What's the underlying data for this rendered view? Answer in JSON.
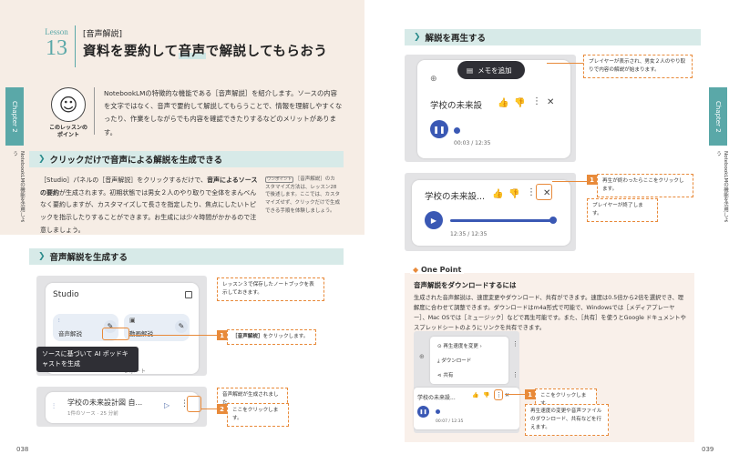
{
  "chapter_tab": {
    "label": "Chapter 2",
    "subtitle": "NotebookLMの機能を活用しよう"
  },
  "lesson": {
    "word": "Lesson",
    "number": "13",
    "tag": "[音声解説]",
    "title_a": "資料を要約して",
    "title_b": "音声",
    "title_c": "で",
    "title_d": "解説してもらおう"
  },
  "point_caption": "このレッスンの\nポイント",
  "intro": "NotebookLMの特徴的な機能である［音声解説］を紹介します。ソースの内容を文字ではなく、音声で要約して解説してもらうことで、情報を理解しやすくなったり、作業をしながらでも内容を確認できたりするなどのメリットがあります。",
  "section1": {
    "title": "クリックだけで音声による解説を生成できる",
    "body_a": "［Studio］パネルの［音声解説］をクリックするだけで、",
    "body_b": "音声によるソースの要約",
    "body_c": "が生成されます。初期状態では男女２人のやり取りで全体をまんべんなく要約しますが、カスタマイズして長さを指定したり、焦点にしたいトピックを指示したりすることができます。お生成には少々時間がかかるので注意しましょう。",
    "note_tag": "ワンポイント",
    "note": "［音声解説］のカスタマイズ方法は、レッスン28で後述します。ここでは、カスタマイズせず、クリックだけで生成できる手順を体験しましょう。"
  },
  "section2": {
    "title": "音声解説を生成する"
  },
  "studio": {
    "title": "Studio",
    "audio_label": "音声解説",
    "video_label": "動画解説",
    "report_label": "レポート",
    "tooltip": "ソースに基づいて AI ポッドキャストを生成"
  },
  "generated": {
    "title": "学校の未来設計図 自...",
    "meta": "1件のソース · 25 分前"
  },
  "callouts_left": {
    "note1": "レッスン３で保存したノートブックを表示しておきます。",
    "step1_num": "1",
    "step1_a": "［音声解説］",
    "step1_b": "をクリックします。",
    "note2": "音声解説が生成されました。",
    "step2_num": "2",
    "step2": "ここをクリックします。"
  },
  "page_left": "038",
  "page_right": "039",
  "section3": {
    "title": "解説を再生する"
  },
  "player1": {
    "memo_label": "メモを追加",
    "title": "学校の未来設",
    "time": "00:03 / 12:35",
    "progress": 0.004
  },
  "player2": {
    "title": "学校の未来設...",
    "time": "12:35 / 12:35",
    "progress": 1.0
  },
  "callouts_right": {
    "note1": "プレイヤーが表示され、男女２人のやり取りで内容の解説が始まります。",
    "step1_num": "1",
    "step1": "再生が終わったらここをクリックします。",
    "note2": "プレイヤーが終了します。"
  },
  "one_point": {
    "badge": "One Point",
    "title": "音声解説をダウンロードするには",
    "body": "生成された音声解説は、速度変更やダウンロード、共有ができます。速度は0.5倍から2倍を選択でき、理解度に合わせて調整できます。ダウンロードはm4a形式で可能で、Windowsでは［メディアプレーヤー］、Mac OSでは［ミュージック］などで再生可能です。また、［共有］を使うとGoogle ドキュメントやスプレッドシートのようにリンクを共有できます。",
    "menu": [
      "再生速度を変更",
      "ダウンロード",
      "共有"
    ],
    "mini_title": "学校の未来設...",
    "mini_time": "00:07 / 12:35",
    "step_num": "1",
    "step": "ここをクリックします。",
    "note": "再生速度の変更や音声ファイルのダウンロード、共有などを行えます。"
  }
}
